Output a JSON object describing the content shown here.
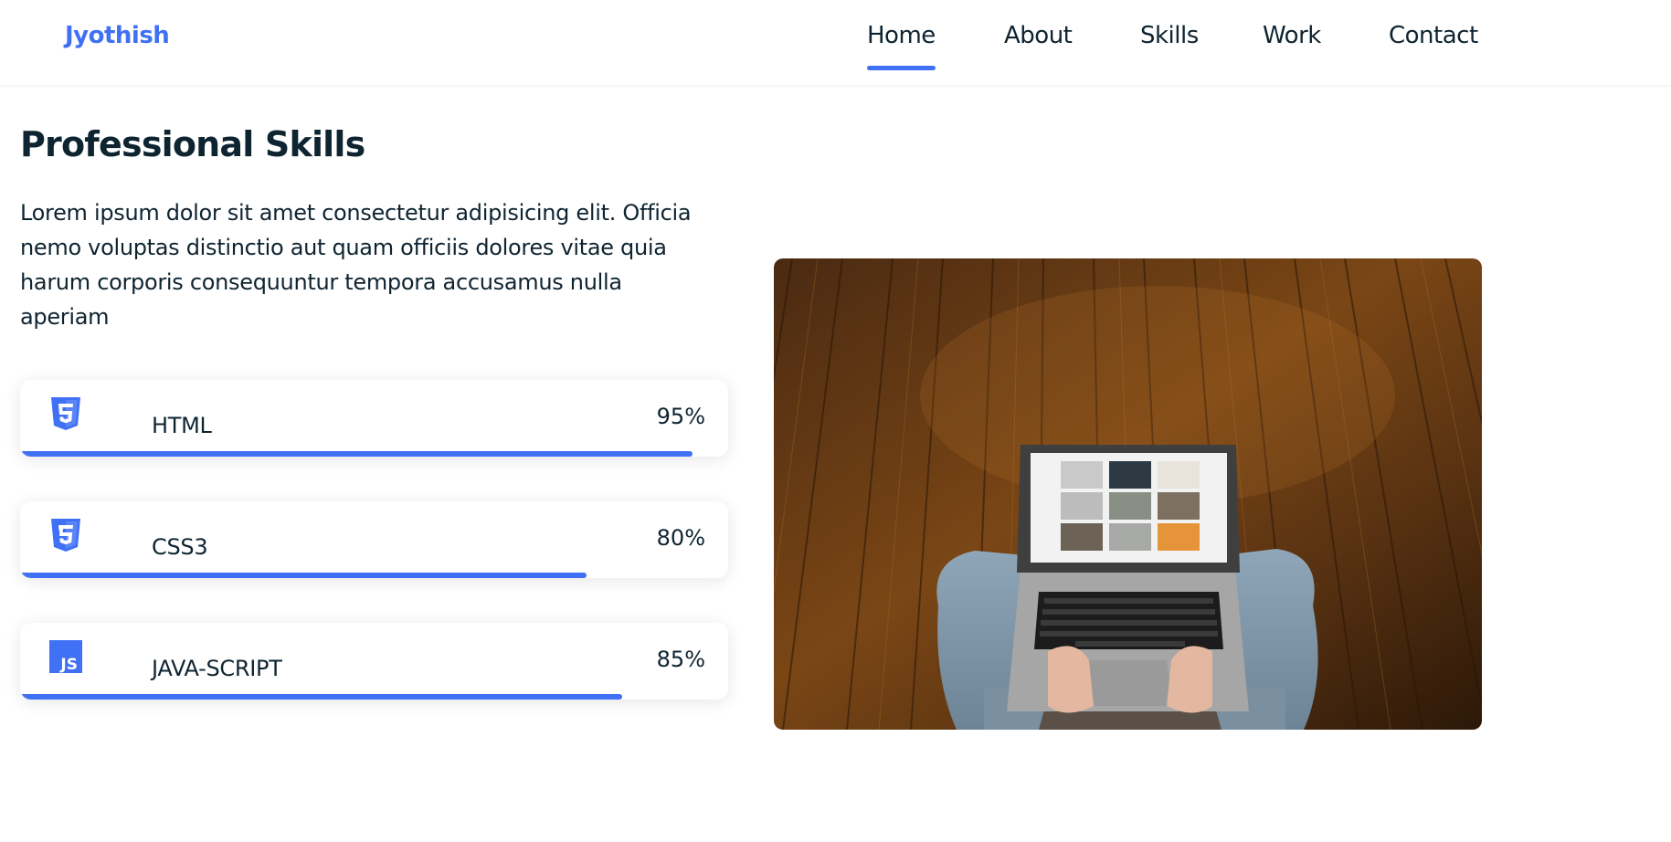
{
  "header": {
    "logo": "Jyothish",
    "nav": [
      {
        "label": "Home",
        "active": true
      },
      {
        "label": "About",
        "active": false
      },
      {
        "label": "Skills",
        "active": false
      },
      {
        "label": "Work",
        "active": false
      },
      {
        "label": "Contact",
        "active": false
      }
    ]
  },
  "skills": {
    "title": "Professional Skills",
    "description": "Lorem ipsum dolor sit amet consectetur adipisicing elit. Officia nemo voluptas distinctio aut quam officiis dolores vitae quia harum corporis consequuntur tempora accusamus nulla aperiam",
    "items": [
      {
        "name": "HTML",
        "percent_label": "95%",
        "level": 0.95,
        "icon": "html5-icon"
      },
      {
        "name": "CSS3",
        "percent_label": "80%",
        "level": 0.8,
        "icon": "css3-icon"
      },
      {
        "name": "JAVA-SCRIPT",
        "percent_label": "85%",
        "level": 0.85,
        "icon": "javascript-icon"
      }
    ],
    "accent_color": "#4070f4"
  },
  "photo": {
    "icon": "laptop-on-wood-floor-photo"
  }
}
